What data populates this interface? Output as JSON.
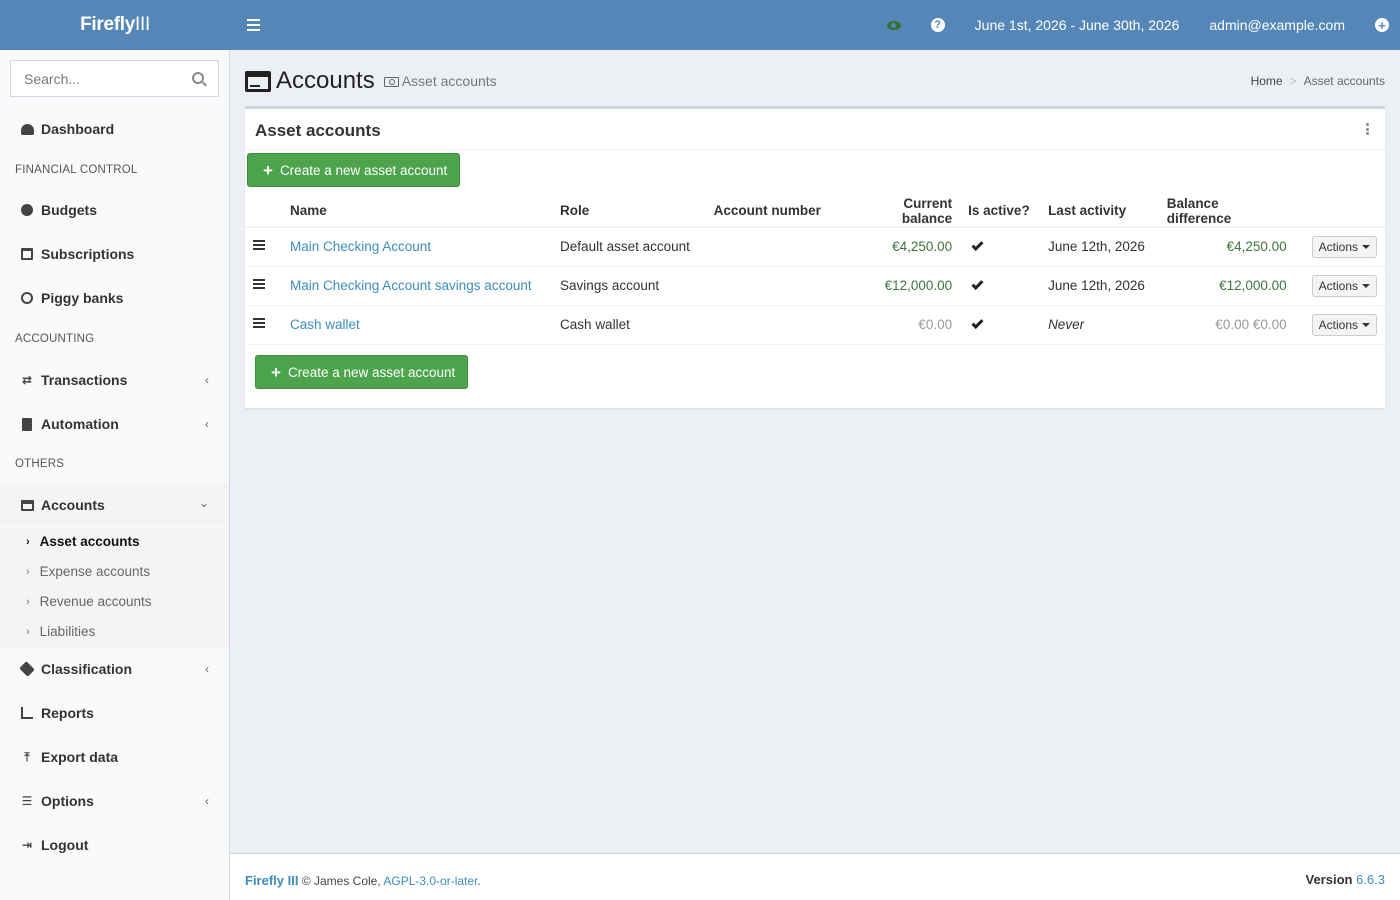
{
  "app": {
    "logo_bold": "Firefly",
    "logo_light": "III"
  },
  "topbar": {
    "date_range": "June 1st, 2026 - June 30th, 2026",
    "user_email": "admin@example.com"
  },
  "sidebar": {
    "search_placeholder": "Search...",
    "dashboard": "Dashboard",
    "header_financial": "FINANCIAL CONTROL",
    "budgets": "Budgets",
    "subscriptions": "Subscriptions",
    "piggy_banks": "Piggy banks",
    "header_accounting": "ACCOUNTING",
    "transactions": "Transactions",
    "automation": "Automation",
    "header_others": "OTHERS",
    "accounts": "Accounts",
    "sub": {
      "asset": "Asset accounts",
      "expense": "Expense accounts",
      "revenue": "Revenue accounts",
      "liabilities": "Liabilities"
    },
    "classification": "Classification",
    "reports": "Reports",
    "export": "Export data",
    "options": "Options",
    "logout": "Logout"
  },
  "page": {
    "title": "Accounts",
    "subtitle": "Asset accounts",
    "breadcrumb_home": "Home",
    "breadcrumb_sep": ">",
    "breadcrumb_current": "Asset accounts"
  },
  "box": {
    "title": "Asset accounts",
    "create_button_top": "Create a new asset account",
    "create_button_bottom": "Create a new asset account"
  },
  "table": {
    "headers": {
      "name": "Name",
      "role": "Role",
      "account_number": "Account number",
      "current_balance": "Current balance",
      "is_active": "Is active?",
      "last_activity": "Last activity",
      "balance_difference": "Balance difference"
    },
    "rows": [
      {
        "name": "Main Checking Account",
        "role": "Default asset account",
        "account_number": "",
        "current_balance": "€4,250.00",
        "last_activity": "June 12th, 2026",
        "balance_difference": "€4,250.00",
        "actions": "Actions"
      },
      {
        "name": "Main Checking Account savings account",
        "role": "Savings account",
        "account_number": "",
        "current_balance": "€12,000.00",
        "last_activity": "June 12th, 2026",
        "balance_difference": "€12,000.00",
        "actions": "Actions"
      },
      {
        "name": "Cash wallet",
        "role": "Cash wallet",
        "account_number": "",
        "current_balance": "€0.00",
        "last_activity": "Never",
        "balance_difference": "€0.00 €0.00",
        "actions": "Actions"
      }
    ]
  },
  "footer": {
    "app_name": "Firefly III",
    "copyright": "© James Cole,",
    "license": "AGPL-3.0-or-later",
    "license_suffix": ".",
    "version_label": "Version",
    "version": "6.6.3"
  },
  "colors": {
    "topbar": "#5487b8",
    "link": "#3c8dbc",
    "success": "#4ea34d",
    "positive_amount": "#3c763d"
  }
}
